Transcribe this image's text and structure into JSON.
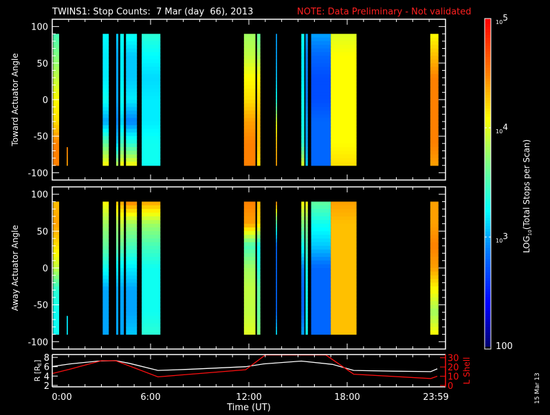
{
  "title": {
    "main": "TWINS1: Stop Counts:  7 Mar (day  66), 2013",
    "note": "NOTE: Data Preliminary - Not validated"
  },
  "side_date": "15 Mar 13",
  "colors": {
    "note": "#ff2020",
    "lshell": "#ff1010",
    "axes": "#ffffff"
  },
  "chart_data": [
    {
      "type": "heatmap",
      "name": "toward",
      "ylabel": "Toward Actuator Angle",
      "ylim": [
        -110,
        110
      ],
      "yticks": [
        100,
        50,
        0,
        -50,
        -100
      ],
      "ytick_labels": [
        "100",
        "50",
        "0",
        "-50",
        "-100"
      ],
      "x_unit": "hours UT",
      "xlim": [
        0,
        24
      ],
      "profile_angles": [
        90,
        60,
        30,
        0,
        -30,
        -60,
        -90
      ],
      "bands": [
        {
          "start": 0.06,
          "end": 0.42,
          "log_counts": [
            3.5,
            3.7,
            3.9,
            4.1,
            4.2,
            4.5,
            4.5
          ]
        },
        {
          "start": 0.88,
          "end": 0.95,
          "angle_range": [
            -65,
            -90
          ],
          "log_counts": [
            4.5,
            4.5,
            4.5,
            4.5,
            4.5,
            4.5,
            4.4
          ]
        },
        {
          "start": 3.08,
          "end": 3.45,
          "log_counts": [
            3.25,
            3.2,
            3.2,
            3.3,
            3.0,
            3.6,
            4.1
          ]
        },
        {
          "start": 3.9,
          "end": 4.03,
          "log_counts": [
            3.1,
            3.0,
            3.0,
            3.0,
            2.9,
            3.1,
            3.9
          ]
        },
        {
          "start": 4.15,
          "end": 4.37,
          "log_counts": [
            3.3,
            3.2,
            3.2,
            3.3,
            3.1,
            3.5,
            4.1
          ]
        },
        {
          "start": 4.5,
          "end": 5.17,
          "log_counts": [
            3.3,
            3.1,
            3.1,
            3.2,
            2.9,
            3.4,
            4.1
          ]
        },
        {
          "start": 5.46,
          "end": 6.6,
          "log_counts": [
            3.4,
            3.25,
            3.15,
            3.2,
            3.2,
            3.3,
            3.3
          ]
        },
        {
          "start": 11.7,
          "end": 12.4,
          "log_counts": [
            3.8,
            3.9,
            4.1,
            4.2,
            4.4,
            4.5,
            4.5
          ]
        },
        {
          "start": 12.5,
          "end": 12.7,
          "log_counts": [
            3.6,
            3.8,
            4.1,
            4.2,
            4.3,
            4.3,
            4.2
          ]
        },
        {
          "start": 13.65,
          "end": 13.72,
          "log_counts": [
            3.0,
            3.0,
            3.1,
            3.3,
            4.0,
            4.3,
            4.4
          ]
        },
        {
          "start": 15.2,
          "end": 15.38,
          "log_counts": [
            3.3,
            3.2,
            3.2,
            3.3,
            3.3,
            3.4,
            4.0
          ]
        },
        {
          "start": 15.46,
          "end": 15.6,
          "log_counts": [
            3.0,
            2.9,
            2.9,
            2.9,
            3.0,
            3.0,
            3.1
          ]
        },
        {
          "start": 15.8,
          "end": 17.0,
          "log_counts": [
            3.0,
            2.8,
            2.7,
            2.7,
            2.8,
            2.8,
            2.8
          ]
        },
        {
          "start": 17.0,
          "end": 18.57,
          "log_counts": [
            4.0,
            4.1,
            4.1,
            4.1,
            4.1,
            4.1,
            4.2
          ]
        },
        {
          "start": 23.07,
          "end": 23.57,
          "log_counts": [
            4.1,
            4.3,
            4.5,
            4.5,
            4.5,
            4.5,
            4.4
          ]
        }
      ]
    },
    {
      "type": "heatmap",
      "name": "away",
      "ylabel": "Away Actuator Angle",
      "ylim": [
        -110,
        110
      ],
      "yticks": [
        100,
        50,
        0,
        -50,
        -100
      ],
      "ytick_labels": [
        "100",
        "50",
        "0",
        "-50",
        "-100"
      ],
      "x_unit": "hours UT",
      "xlim": [
        0,
        24
      ],
      "profile_angles": [
        90,
        60,
        30,
        0,
        -30,
        -60,
        -90
      ],
      "bands": [
        {
          "start": 0.06,
          "end": 0.42,
          "log_counts": [
            4.3,
            4.4,
            4.2,
            3.9,
            3.4,
            3.3,
            3.3
          ]
        },
        {
          "start": 0.88,
          "end": 0.95,
          "angle_range": [
            -65,
            -90
          ],
          "log_counts": [
            3.2,
            3.2,
            3.2,
            3.2,
            3.2,
            3.2,
            3.2
          ]
        },
        {
          "start": 3.08,
          "end": 3.45,
          "log_counts": [
            4.1,
            3.8,
            3.6,
            3.3,
            3.0,
            3.0,
            3.0
          ]
        },
        {
          "start": 3.9,
          "end": 4.03,
          "log_counts": [
            4.3,
            3.8,
            3.6,
            3.2,
            3.0,
            3.0,
            3.0
          ]
        },
        {
          "start": 4.15,
          "end": 4.37,
          "log_counts": [
            4.4,
            3.9,
            3.6,
            3.2,
            3.0,
            3.0,
            3.0
          ]
        },
        {
          "start": 4.5,
          "end": 5.17,
          "log_counts": [
            4.5,
            3.8,
            3.5,
            3.2,
            3.0,
            3.0,
            3.1
          ]
        },
        {
          "start": 5.46,
          "end": 6.6,
          "log_counts": [
            4.4,
            3.8,
            3.5,
            3.3,
            3.3,
            3.3,
            3.4
          ]
        },
        {
          "start": 11.7,
          "end": 12.4,
          "log_counts": [
            4.5,
            4.4,
            3.5,
            3.8,
            3.9,
            3.9,
            4.0
          ]
        },
        {
          "start": 12.5,
          "end": 12.7,
          "log_counts": [
            4.3,
            4.2,
            3.3,
            3.4,
            3.6,
            3.6,
            3.7
          ]
        },
        {
          "start": 13.65,
          "end": 13.72,
          "log_counts": [
            4.5,
            3.5,
            2.8,
            2.8,
            2.8,
            2.8,
            3.2
          ]
        },
        {
          "start": 15.2,
          "end": 15.38,
          "log_counts": [
            4.1,
            3.7,
            3.3,
            2.9,
            2.8,
            2.8,
            3.0
          ]
        },
        {
          "start": 15.46,
          "end": 15.6,
          "log_counts": [
            4.1,
            3.7,
            3.5,
            3.3,
            3.3,
            3.3,
            3.3
          ]
        },
        {
          "start": 15.8,
          "end": 17.0,
          "log_counts": [
            3.6,
            3.3,
            3.1,
            2.8,
            2.8,
            2.8,
            2.8
          ]
        },
        {
          "start": 17.0,
          "end": 18.57,
          "log_counts": [
            4.4,
            4.3,
            4.3,
            4.3,
            4.3,
            4.3,
            4.3
          ]
        },
        {
          "start": 23.07,
          "end": 23.57,
          "log_counts": [
            4.4,
            4.4,
            4.5,
            4.4,
            4.1,
            3.8,
            4.1
          ]
        }
      ]
    },
    {
      "type": "line",
      "name": "ephemeris",
      "xlabel": "Time (UT)",
      "xlim": [
        0,
        24
      ],
      "xticks": [
        0,
        6,
        12,
        18,
        24
      ],
      "xtick_labels": [
        "0:00",
        "6:00",
        "12:00",
        "18:00",
        "23:59"
      ],
      "ylabel": "R [R",
      "ylabel_sub": "E",
      "ylabel_end": "]",
      "ylim": [
        1.7,
        8.6
      ],
      "yticks_labels": [
        "8",
        "6",
        "4",
        "2"
      ],
      "yticks": [
        8,
        6,
        4,
        2
      ],
      "y2label": "L Shell",
      "y2lim": [
        0,
        32
      ],
      "y2ticks": [
        30,
        20,
        10,
        0
      ],
      "y2tick_labels": [
        "30",
        "20",
        "10",
        "0"
      ],
      "series": [
        {
          "name": "R",
          "axis": "left",
          "color": "#ffffff",
          "x": [
            0,
            1.09,
            2.8,
            3.87,
            4.73,
            6.45,
            8.4,
            11.8,
            12.9,
            15.2,
            17.1,
            18.4,
            20.8,
            23.1,
            23.5
          ],
          "y": [
            6.05,
            6.6,
            7.2,
            7.3,
            6.7,
            5.2,
            5.45,
            6.0,
            6.6,
            7.2,
            6.5,
            5.2,
            5.05,
            4.95,
            5.55
          ]
        },
        {
          "name": "L Shell",
          "axis": "right",
          "color": "#ff1010",
          "x": [
            0,
            1.09,
            3.0,
            3.87,
            6.45,
            11.8,
            13.0,
            16.7,
            18.4,
            23.1,
            23.5
          ],
          "y": [
            12.9,
            17.7,
            26.8,
            26.8,
            9.3,
            17.0,
            33,
            33,
            12.2,
            7.5,
            10.0
          ]
        }
      ]
    }
  ],
  "colorbar": {
    "label_prefix": "LOG",
    "label_sub": "10",
    "label_rest": "(Total Stops per Scan)",
    "range_log": [
      2,
      5
    ],
    "ticks": [
      {
        "log": 5,
        "base": "10",
        "exp": "5"
      },
      {
        "log": 4,
        "base": "10",
        "exp": "4"
      },
      {
        "log": 3,
        "base": "10",
        "exp": "3"
      },
      {
        "log": 2,
        "base": "100",
        "exp": ""
      }
    ]
  }
}
